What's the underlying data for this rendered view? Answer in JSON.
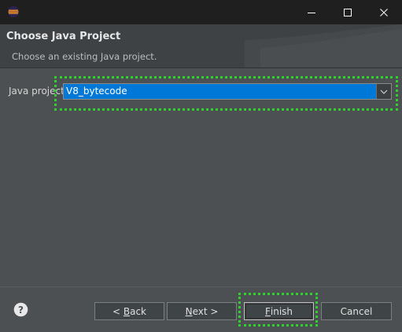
{
  "window": {
    "icon": "eclipse-icon",
    "controls": [
      "minimize-icon",
      "maximize-icon",
      "close-icon"
    ]
  },
  "banner": {
    "title": "Choose Java Project",
    "description": "Choose an existing Java project."
  },
  "form": {
    "java_project_label": "Java project:",
    "java_project_value": "V8_bytecode"
  },
  "buttons": {
    "help_icon": "help-icon",
    "back_mnemonic": "< ",
    "back_underlined": "B",
    "back_rest": "ack",
    "next_underlined": "N",
    "next_rest": "ext >",
    "finish_underlined": "F",
    "finish_rest": "inish",
    "cancel": "Cancel"
  },
  "colors": {
    "background": "#4c5052",
    "titlebar": "#1f1f1f",
    "selection": "#0078d7",
    "highlight": "#2ed12e"
  }
}
